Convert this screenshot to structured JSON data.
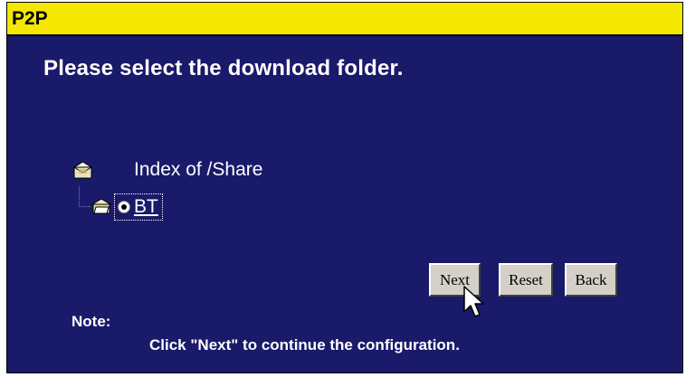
{
  "app": {
    "title": "P2P"
  },
  "main": {
    "heading": "Please select the download folder.",
    "tree": {
      "root_label": "Index of /Share",
      "root_icon": "folder-share-icon",
      "child": {
        "label": "BT",
        "icon": "open-folder-icon",
        "selected": true
      }
    },
    "buttons": {
      "next": "Next",
      "reset": "Reset",
      "back": "Back"
    },
    "note": {
      "label": "Note:",
      "text": "Click \"Next\" to continue the configuration."
    }
  },
  "colors": {
    "titlebar": "#f4e800",
    "background": "#1a1a6b",
    "text": "#ffffff",
    "button": "#d4d0c8"
  }
}
